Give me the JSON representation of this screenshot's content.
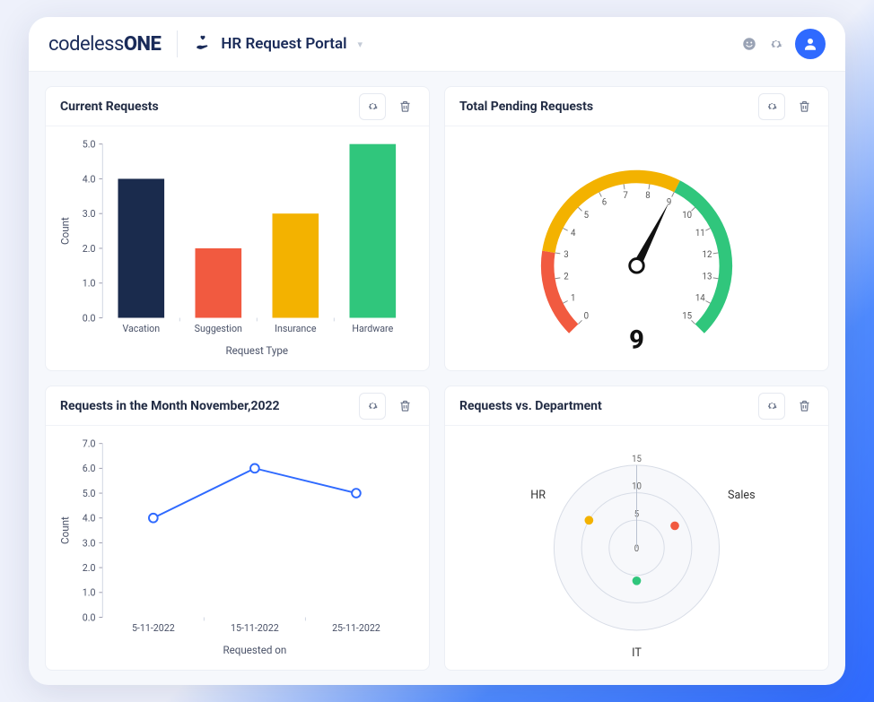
{
  "header": {
    "logo_a": "codeless",
    "logo_b": "ONE",
    "portal_title": "HR Request Portal"
  },
  "cards": {
    "bar": {
      "title": "Current Requests",
      "xlabel": "Request Type",
      "ylabel": "Count"
    },
    "gauge": {
      "title": "Total Pending Requests"
    },
    "line": {
      "title": "Requests in the Month November,2022",
      "xlabel": "Requested on",
      "ylabel": "Count"
    },
    "polar": {
      "title": "Requests vs. Department"
    }
  },
  "chart_data": [
    {
      "id": "bar",
      "type": "bar",
      "title": "Current Requests",
      "xlabel": "Request Type",
      "ylabel": "Count",
      "ylim": [
        0,
        5
      ],
      "ytick_step": 1.0,
      "categories": [
        "Vacation",
        "Suggestion",
        "Insurance",
        "Hardware"
      ],
      "values": [
        4,
        2,
        3,
        5
      ],
      "colors": [
        "#1a2b4d",
        "#f15a40",
        "#f3b200",
        "#30c67c"
      ]
    },
    {
      "id": "gauge",
      "type": "gauge",
      "title": "Total Pending Requests",
      "min": 0,
      "max": 15,
      "value": 9,
      "segments": [
        {
          "from": 0,
          "to": 3,
          "color": "#f15a40"
        },
        {
          "from": 3,
          "to": 9,
          "color": "#f3b200"
        },
        {
          "from": 9,
          "to": 15,
          "color": "#30c67c"
        }
      ]
    },
    {
      "id": "line",
      "type": "line",
      "title": "Requests in the Month November,2022",
      "xlabel": "Requested on",
      "ylabel": "Count",
      "ylim": [
        0,
        7
      ],
      "ytick_step": 1.0,
      "categories": [
        "5-11-2022",
        "15-11-2022",
        "25-11-2022"
      ],
      "values": [
        4,
        6,
        5
      ],
      "color": "#2f6aff"
    },
    {
      "id": "polar",
      "type": "scatter-polar",
      "title": "Requests vs. Department",
      "rlim": [
        0,
        15
      ],
      "rticks": [
        0,
        5,
        10,
        15
      ],
      "categories": [
        "HR",
        "Sales",
        "IT"
      ],
      "points": [
        {
          "category": "HR",
          "value": 10,
          "color": "#f3b200"
        },
        {
          "category": "Sales",
          "value": 8,
          "color": "#f15a40"
        },
        {
          "category": "IT",
          "value": 6,
          "color": "#30c67c"
        }
      ]
    }
  ]
}
